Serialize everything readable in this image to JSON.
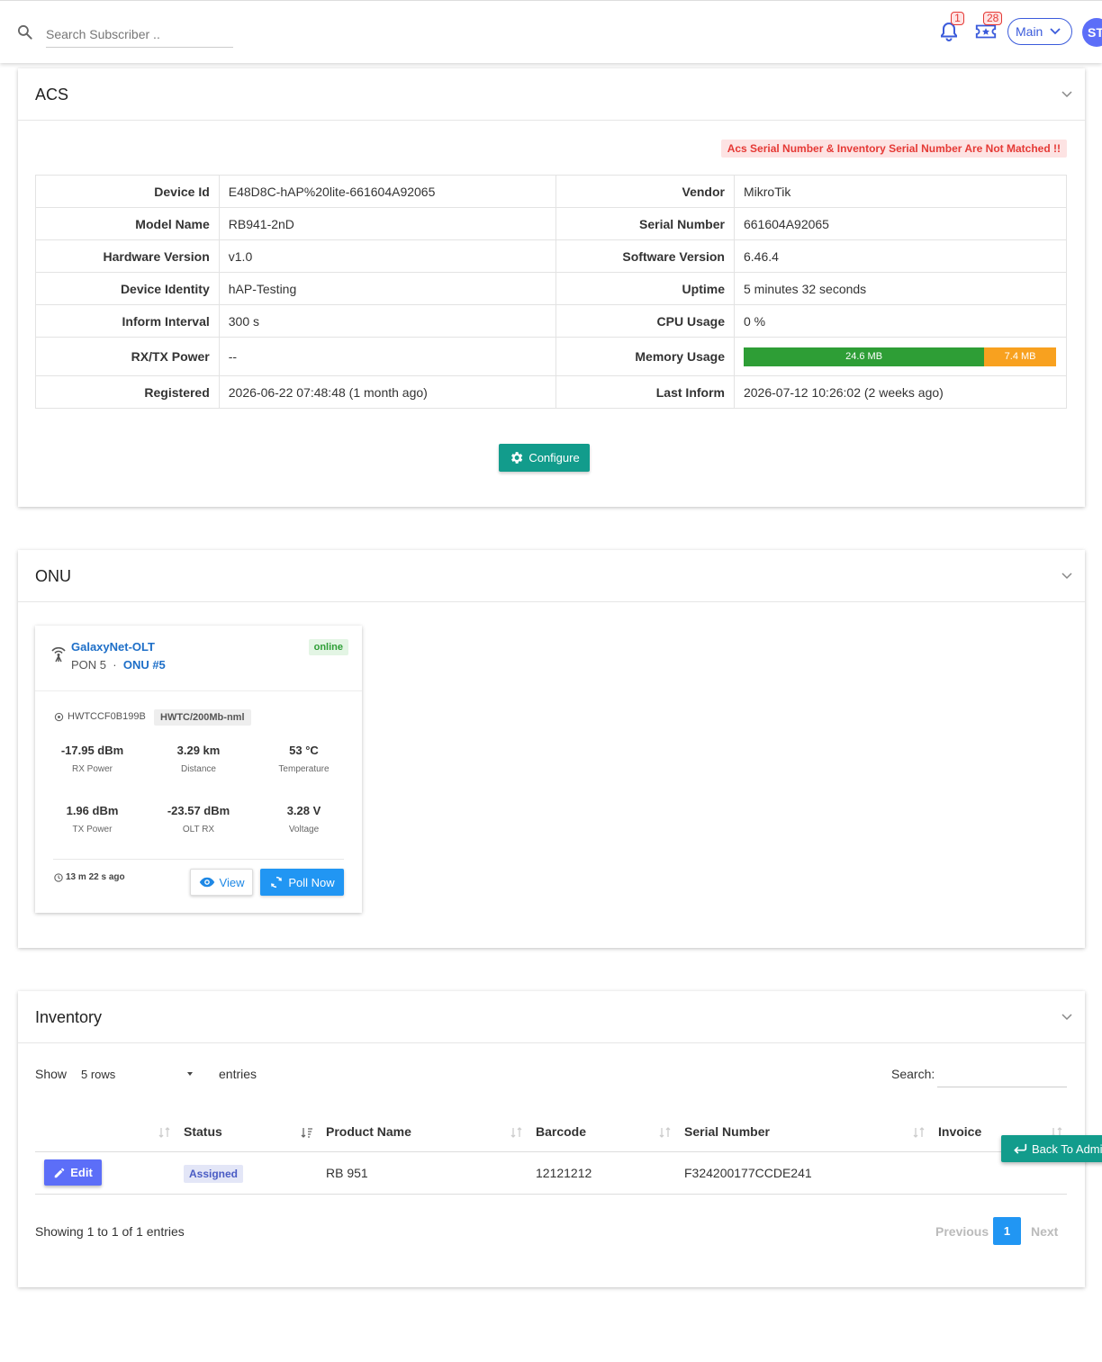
{
  "topbar": {
    "search_placeholder": "Search Subscriber ..",
    "notifications_count": "1",
    "tickets_count": "28",
    "branch_select": "Main",
    "avatar_initials": "ST"
  },
  "acs": {
    "title": "ACS",
    "mismatch_warning": "Acs Serial Number & Inventory Serial Number Are Not Matched !!",
    "rows": [
      {
        "l1": "Device Id",
        "v1": "E48D8C-hAP%20lite-661604A92065",
        "l2": "Vendor",
        "v2": "MikroTik"
      },
      {
        "l1": "Model Name",
        "v1": "RB941-2nD",
        "l2": "Serial Number",
        "v2": "661604A92065"
      },
      {
        "l1": "Hardware Version",
        "v1": "v1.0",
        "l2": "Software Version",
        "v2": "6.46.4"
      },
      {
        "l1": "Device Identity",
        "v1": "hAP-Testing",
        "l2": "Uptime",
        "v2": "5 minutes 32 seconds"
      },
      {
        "l1": "Inform Interval",
        "v1": "300 s",
        "l2": "CPU Usage",
        "v2": "0 %"
      },
      {
        "l1": "RX/TX Power",
        "v1": "--",
        "l2": "Memory Usage",
        "v2": ""
      },
      {
        "l1": "Registered",
        "v1": "2026-06-22 07:48:48 (1 month ago)",
        "l2": "Last Inform",
        "v2": "2026-07-12 10:26:02 (2 weeks ago)"
      }
    ],
    "memory": {
      "used": "24.6 MB",
      "free": "7.4 MB",
      "used_fraction": 0.77
    },
    "configure_label": "Configure"
  },
  "onu": {
    "title": "ONU",
    "olt_name": "GalaxyNet-OLT",
    "pon": "PON 5",
    "separator": "·",
    "onu_label": "ONU #5",
    "status": "online",
    "serial": "HWTCCF0B199B",
    "profile": "HWTC/200Mb-nml",
    "metrics": [
      {
        "value": "-17.95 dBm",
        "label": "RX Power"
      },
      {
        "value": "3.29 km",
        "label": "Distance"
      },
      {
        "value": "53 °C",
        "label": "Temperature"
      },
      {
        "value": "1.96 dBm",
        "label": "TX Power"
      },
      {
        "value": "-23.57 dBm",
        "label": "OLT RX"
      },
      {
        "value": "3.28 V",
        "label": "Voltage"
      }
    ],
    "last_poll": "13 m 22 s ago",
    "view_label": "View",
    "poll_label": "Poll Now"
  },
  "inventory": {
    "title": "Inventory",
    "show_label": "Show",
    "rows_option": "5 rows",
    "entries_label": "entries",
    "search_label": "Search:",
    "columns": [
      "",
      "Status",
      "Product Name",
      "Barcode",
      "Serial Number",
      "Invoice"
    ],
    "row": {
      "edit_label": "Edit",
      "status": "Assigned",
      "product": "RB 951",
      "barcode": "12121212",
      "serial": "F324200177CCDE241",
      "invoice": ""
    },
    "showing": "Showing 1 to 1 of 1 entries",
    "prev": "Previous",
    "page": "1",
    "next": "Next"
  },
  "back_button": "Back To Admin"
}
